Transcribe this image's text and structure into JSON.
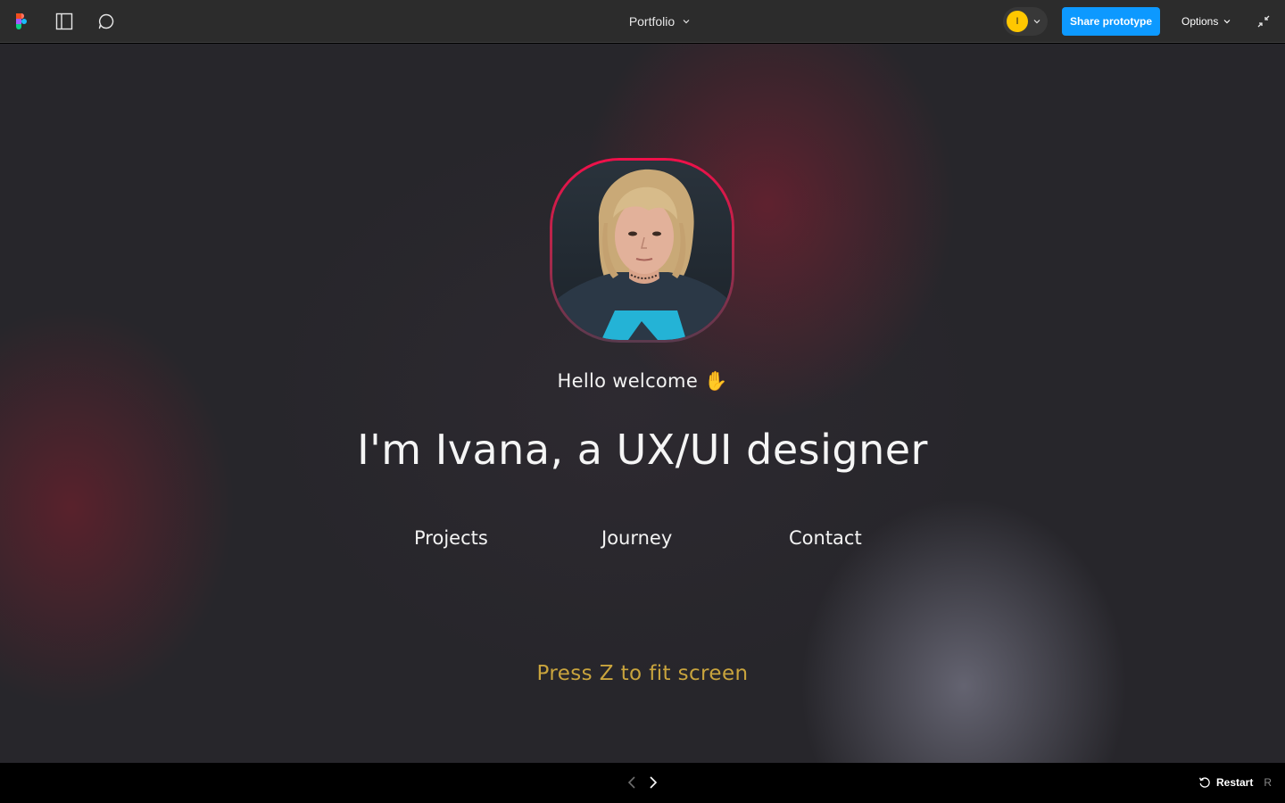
{
  "topbar": {
    "file_title": "Portfolio",
    "avatar_initial": "I",
    "share_label": "Share prototype",
    "options_label": "Options",
    "icons": {
      "logo": "figma-logo-icon",
      "panel": "sidebar-panel-icon",
      "comment": "comment-icon",
      "collapse": "collapse-arrows-icon"
    },
    "colors": {
      "accent": "#0d99ff",
      "avatar": "#ffc700"
    }
  },
  "frame": {
    "greeting": "Hello welcome ✋",
    "headline": "I'm Ivana, a UX/UI designer",
    "nav": {
      "projects": "Projects",
      "journey": "Journey",
      "contact": "Contact"
    },
    "hint": "Press Z to fit screen",
    "colors": {
      "portrait_ring_top": "#f0104a",
      "hint": "#c9a43d"
    }
  },
  "bottombar": {
    "restart_label": "Restart",
    "restart_shortcut": "R"
  }
}
